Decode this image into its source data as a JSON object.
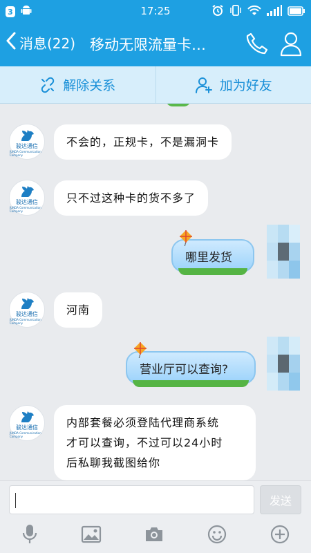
{
  "status_bar": {
    "badge": "3",
    "time": "17:25"
  },
  "header": {
    "back_label": "消息(22)",
    "title": "移动无限流量卡…"
  },
  "actions": {
    "unbind_label": "解除关系",
    "add_friend_label": "加为好友"
  },
  "contact": {
    "avatar_brand": "骏达通信",
    "avatar_sub": "JUNDA Communication Company"
  },
  "messages": [
    {
      "from": "contact",
      "text": "不会的，正规卡，不是漏洞卡"
    },
    {
      "from": "contact",
      "text": "只不过这种卡的货不多了"
    },
    {
      "from": "me",
      "text": "哪里发货"
    },
    {
      "from": "contact",
      "text": "河南"
    },
    {
      "from": "me",
      "text": "营业厅可以查询?"
    },
    {
      "from": "contact",
      "lines": [
        "内部套餐必须登陆代理商系统",
        "才可以查询，不过可以24小时",
        "后私聊我截图给你"
      ]
    }
  ],
  "composer": {
    "input_value": "",
    "send_label": "发送"
  },
  "toolbar": {
    "icons": [
      "microphone-icon",
      "image-icon",
      "camera-icon",
      "emoji-icon",
      "plus-icon"
    ]
  },
  "colors": {
    "brand_blue": "#1ea0e2",
    "bubble_out": "#9cd3fb",
    "grass": "#55b444",
    "chat_bg": "#e9ebee"
  }
}
